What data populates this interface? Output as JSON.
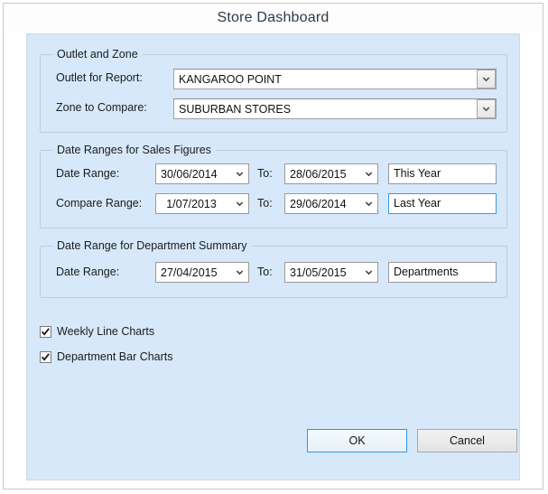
{
  "window": {
    "title": "Store Dashboard"
  },
  "groups": {
    "outlet": {
      "legend": "Outlet and Zone",
      "rows": [
        {
          "label": "Outlet for Report:",
          "value": "KANGAROO POINT"
        },
        {
          "label": "Zone to Compare:",
          "value": "SUBURBAN STORES"
        }
      ]
    },
    "sales": {
      "legend": "Date Ranges for Sales Figures",
      "to_label": "To:",
      "rows": [
        {
          "label": "Date Range:",
          "from": "30/06/2014",
          "to": "28/06/2015",
          "caption": "This Year",
          "focused": false
        },
        {
          "label": "Compare Range:",
          "from": "1/07/2013",
          "to": "29/06/2014",
          "caption": "Last Year",
          "focused": true
        }
      ]
    },
    "department": {
      "legend": "Date Range for Department Summary",
      "to_label": "To:",
      "rows": [
        {
          "label": "Date Range:",
          "from": "27/04/2015",
          "to": "31/05/2015",
          "caption": "Departments"
        }
      ]
    }
  },
  "options": [
    {
      "label": "Weekly Line Charts",
      "checked": true
    },
    {
      "label": "Department Bar Charts",
      "checked": true
    }
  ],
  "buttons": {
    "ok": "OK",
    "cancel": "Cancel"
  },
  "colors": {
    "panel_background": "#d6e8fa",
    "focus_blue": "#3f9ade",
    "title_text": "#2b3a4a"
  },
  "icons": {
    "dropdown": "chevron-down-icon",
    "check": "check-icon"
  }
}
